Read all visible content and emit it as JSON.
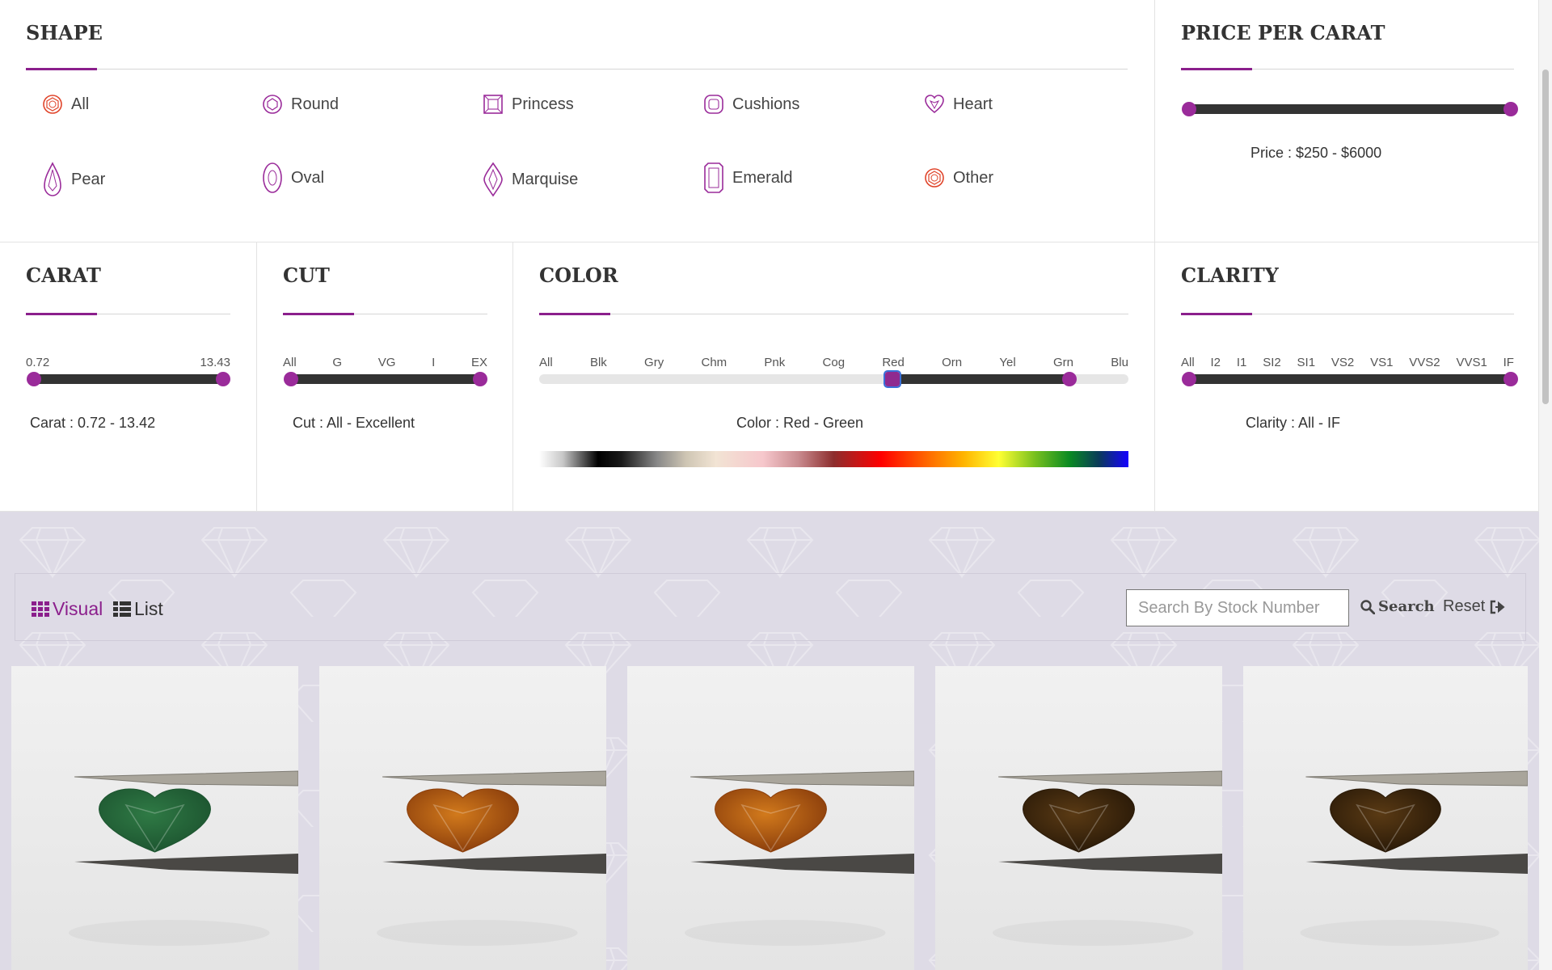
{
  "accent_color": "#8b1f8c",
  "shape": {
    "title": "SHAPE",
    "items": [
      {
        "label": "All",
        "icon": "round-brilliant-icon"
      },
      {
        "label": "Round",
        "icon": "round-icon"
      },
      {
        "label": "Princess",
        "icon": "princess-icon"
      },
      {
        "label": "Cushions",
        "icon": "cushion-icon"
      },
      {
        "label": "Heart",
        "icon": "heart-icon"
      },
      {
        "label": "Pear",
        "icon": "pear-icon"
      },
      {
        "label": "Oval",
        "icon": "oval-icon"
      },
      {
        "label": "Marquise",
        "icon": "marquise-icon"
      },
      {
        "label": "Emerald",
        "icon": "emerald-icon"
      },
      {
        "label": "Other",
        "icon": "round-brilliant-icon"
      }
    ]
  },
  "price": {
    "title": "PRICE PER CARAT",
    "summary": "Price : $250 - $6000",
    "range": [
      0,
      1
    ]
  },
  "carat": {
    "title": "CARAT",
    "min_label": "0.72",
    "max_label": "13.43",
    "summary": "Carat : 0.72 - 13.42",
    "range": [
      0,
      1
    ]
  },
  "cut": {
    "title": "CUT",
    "ticks": [
      "All",
      "G",
      "VG",
      "I",
      "EX"
    ],
    "summary": "Cut : All - Excellent",
    "range": [
      0,
      1
    ]
  },
  "color": {
    "title": "COLOR",
    "ticks": [
      "All",
      "Blk",
      "Gry",
      "Chm",
      "Pnk",
      "Cog",
      "Red",
      "Orn",
      "Yel",
      "Grn",
      "Blu"
    ],
    "summary": "Color : Red - Green",
    "range": [
      0.6,
      0.9
    ]
  },
  "clarity": {
    "title": "CLARITY",
    "ticks": [
      "All",
      "I2",
      "I1",
      "SI2",
      "SI1",
      "VS2",
      "VS1",
      "VVS2",
      "VVS1",
      "IF"
    ],
    "summary": "Clarity : All - IF",
    "range": [
      0,
      1
    ]
  },
  "toolbar": {
    "visual_label": "Visual",
    "list_label": "List",
    "search_placeholder": "Search By Stock Number",
    "search_label": "Search",
    "reset_label": "Reset"
  },
  "products": [
    {
      "stone_color": "#2f7a45",
      "stone_shade": "#1d5530"
    },
    {
      "stone_color": "#d27a1c",
      "stone_shade": "#8c3f0c"
    },
    {
      "stone_color": "#d27a1c",
      "stone_shade": "#8c3f0c"
    },
    {
      "stone_color": "#5a3a14",
      "stone_shade": "#2a1a08"
    },
    {
      "stone_color": "#5a3a14",
      "stone_shade": "#2a1a08"
    }
  ]
}
